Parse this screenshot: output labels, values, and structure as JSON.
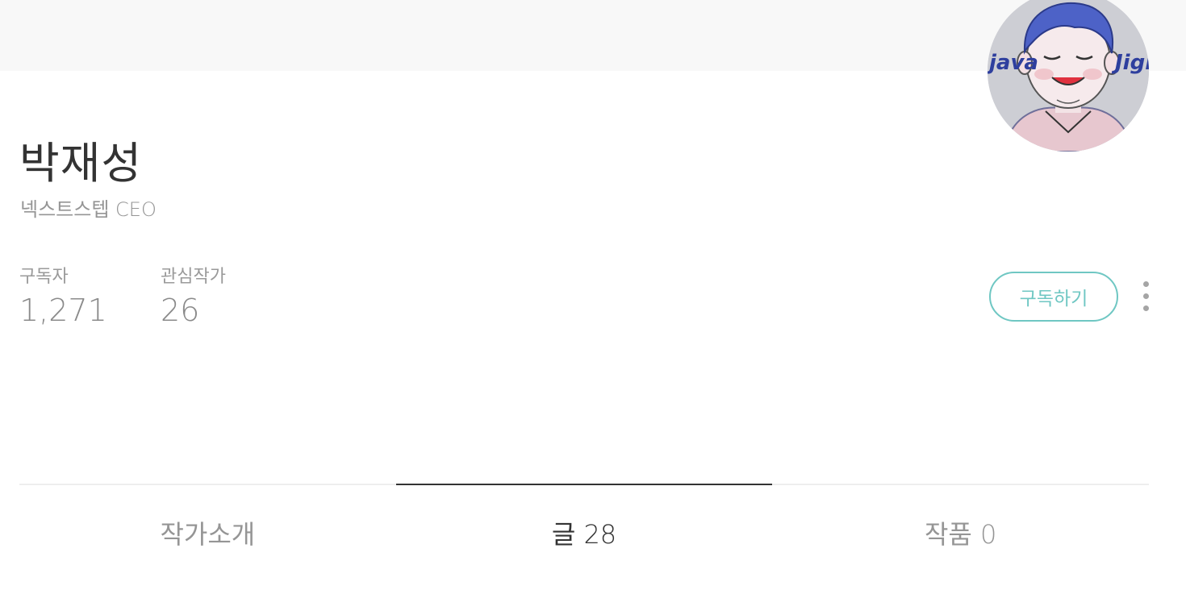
{
  "profile": {
    "name": "박재성",
    "job": "넥스트스텝 CEO",
    "avatar_text_left": "java",
    "avatar_text_right": "Jigi"
  },
  "stats": [
    {
      "label": "구독자",
      "value": "1,271"
    },
    {
      "label": "관심작가",
      "value": "26"
    }
  ],
  "actions": {
    "subscribe_label": "구독하기",
    "more_icon": "more-vertical-icon"
  },
  "tabs": [
    {
      "label": "작가소개",
      "active": false
    },
    {
      "label": "글 28",
      "active": true
    },
    {
      "label": "작품 0",
      "active": false
    }
  ],
  "colors": {
    "accent": "#6fc7c3",
    "text_dark": "#333333",
    "text_muted": "#959595",
    "top_band": "#f8f8f8"
  }
}
